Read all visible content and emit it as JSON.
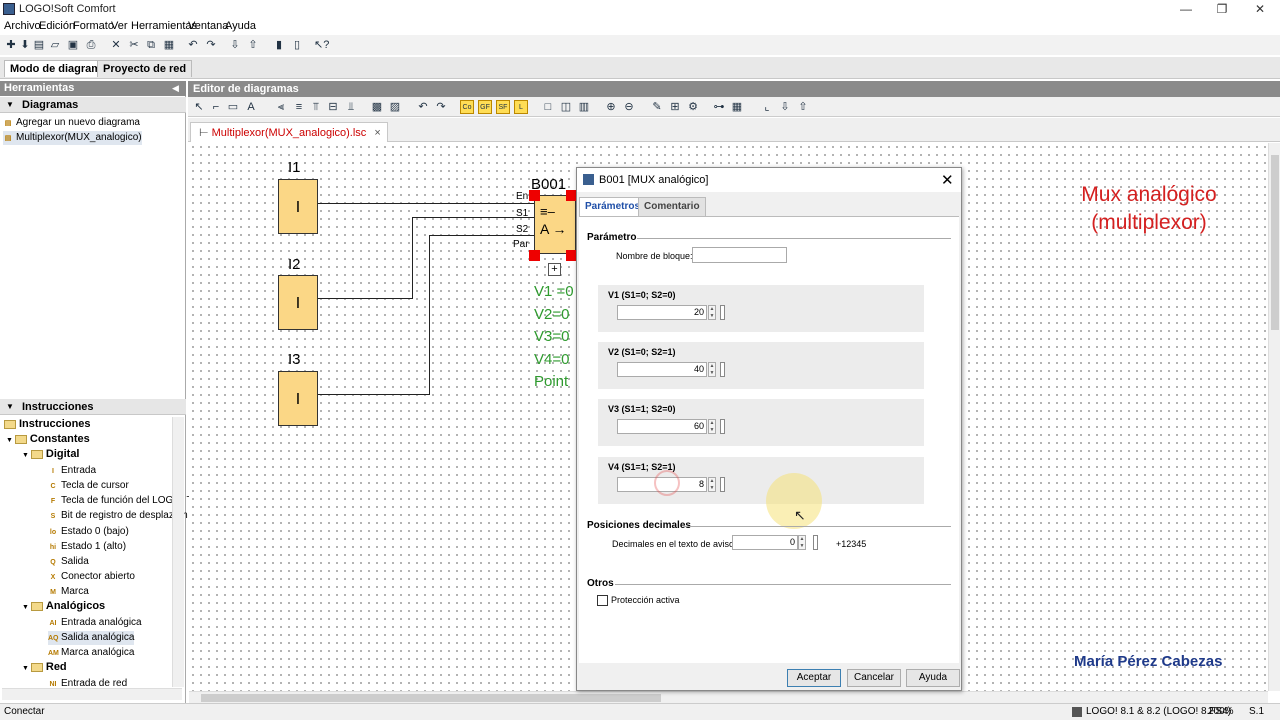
{
  "window": {
    "title": "LOGO!Soft Comfort"
  },
  "menu": [
    "Archivo",
    "Edición",
    "Formato",
    "Ver",
    "Herramientas",
    "Ventana",
    "Ayuda"
  ],
  "mode_tabs": [
    "Modo de diagrama",
    "Proyecto de red"
  ],
  "left_panel": {
    "title": "Herramientas",
    "diagrams_header": "Diagramas",
    "diagram_items": [
      "Agregar un nuevo diagrama",
      "Multiplexor(MUX_analogico)"
    ],
    "instructions_header": "Instrucciones",
    "tree": {
      "root": "Instrucciones",
      "constants": "Constantes",
      "digital": "Digital",
      "digital_items": [
        {
          "icon": "I",
          "label": "Entrada"
        },
        {
          "icon": "C",
          "label": "Tecla de cursor"
        },
        {
          "icon": "F",
          "label": "Tecla de función del LOGO! T"
        },
        {
          "icon": "S",
          "label": "Bit de registro de desplazam"
        },
        {
          "icon": "lo",
          "label": "Estado 0 (bajo)"
        },
        {
          "icon": "hi",
          "label": "Estado 1 (alto)"
        },
        {
          "icon": "Q",
          "label": "Salida"
        },
        {
          "icon": "X",
          "label": "Conector abierto"
        },
        {
          "icon": "M",
          "label": "Marca"
        }
      ],
      "analog": "Analógicos",
      "analog_items": [
        {
          "icon": "AI",
          "label": "Entrada analógica"
        },
        {
          "icon": "AQ",
          "label": "Salida analógica"
        },
        {
          "icon": "AM",
          "label": "Marca analógica"
        }
      ],
      "network": "Red",
      "network_items": [
        {
          "icon": "NI",
          "label": "Entrada de red"
        }
      ]
    }
  },
  "editor": {
    "title": "Editor de diagramas",
    "tab": "Multiplexor(MUX_analogico).lsc",
    "tab_close": "×",
    "blocks": [
      {
        "name": "I1",
        "symbol": "I"
      },
      {
        "name": "I2",
        "symbol": "I"
      },
      {
        "name": "I3",
        "symbol": "I"
      }
    ],
    "mux": {
      "name": "B001",
      "pins": [
        "En",
        "S1",
        "S2",
        "Par"
      ],
      "symbol_top": "≡–",
      "symbol_bottom": "A →",
      "expand": "+"
    },
    "params_text": [
      "V1  =0",
      "V2=0",
      "V3=0",
      "V4=0",
      "Point"
    ],
    "overlay_title": "Mux analógico (multiplexor)",
    "author": "María Pérez Cabezas"
  },
  "dialog": {
    "title": "B001 [MUX analógico]",
    "tabs": [
      "Parámetros",
      "Comentario"
    ],
    "section_param": "Parámetro",
    "block_name_label": "Nombre de bloque:",
    "block_name_value": "",
    "values": [
      {
        "label": "V1 (S1=0; S2=0)",
        "value": "20"
      },
      {
        "label": "V2 (S1=0; S2=1)",
        "value": "40"
      },
      {
        "label": "V3 (S1=1; S2=0)",
        "value": "60"
      },
      {
        "label": "V4 (S1=1; S2=1)",
        "value": "8"
      }
    ],
    "section_decimals": "Posiciones decimales",
    "decimals_label": "Decimales en el texto de aviso:",
    "decimals_value": "0",
    "decimals_preview": "+12345",
    "section_other": "Otros",
    "protection_label": "Protección activa",
    "protection_checked": false,
    "buttons": {
      "ok": "Aceptar",
      "cancel": "Cancelar",
      "help": "Ayuda"
    }
  },
  "status": {
    "left": "Conectar",
    "device": "LOGO! 8.1 & 8.2 (LOGO! 8.FS4)",
    "zoom": "200%",
    "page": "S.1"
  },
  "colors": {
    "overlay_title": "#d42020",
    "author": "#1f3a8a",
    "params_text": "#2e9a2e",
    "block_fill": "#fbd786",
    "pin_marker": "#e00000",
    "active_tab": "#1f4fa8"
  }
}
